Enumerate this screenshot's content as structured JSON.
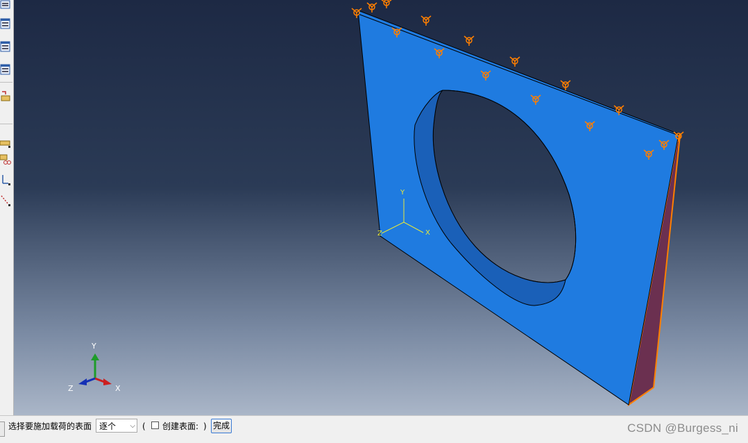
{
  "viewport": {
    "model_csys": {
      "x": "X",
      "y": "Y",
      "z": "Z"
    },
    "view_triad": {
      "x": "X",
      "y": "Y",
      "z": "Z"
    },
    "colors": {
      "part_face": "#1f7be0",
      "part_edge": "#000000",
      "selected_face": "#6b3050",
      "selected_edge": "#ff7f00",
      "boundary_symbol": "#ff7f00",
      "triad_x": "#cc1f1f",
      "triad_y": "#1e9c2a",
      "triad_z": "#1530b5",
      "csys": "#e8e83a"
    }
  },
  "prompt": {
    "label": "选择要施加载荷的表面",
    "selection_mode": "逐个",
    "paren_open": "(",
    "create_surface_label": "创建表面:",
    "paren_close": ")",
    "done_label": "完成",
    "create_surface_checked": false
  },
  "watermark": "CSDN @Burgess_ni"
}
